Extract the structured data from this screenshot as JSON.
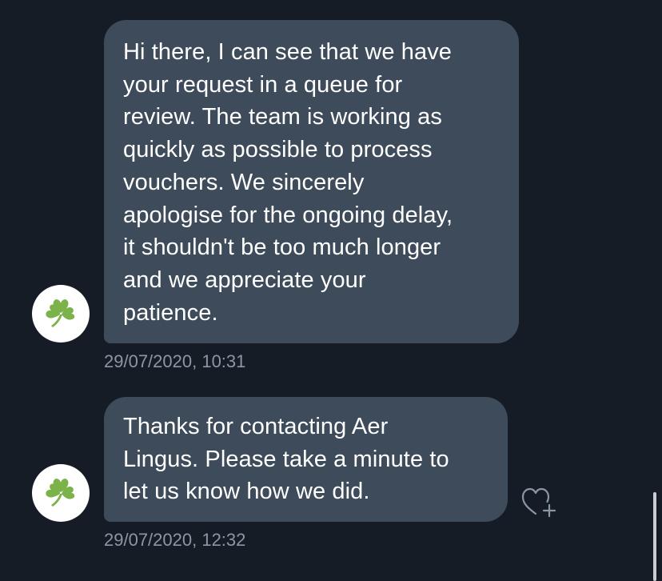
{
  "conversation": {
    "messages": [
      {
        "text": "Hi there, I can see that we have\nyour request in a queue for\nreview. The team is working as\nquickly as possible to process\nvouchers. We sincerely\napologise for the ongoing delay,\nit shouldn't be too much longer\nand we appreciate your\npatience.",
        "timestamp": "29/07/2020, 10:31",
        "avatar_icon": "shamrock-icon"
      },
      {
        "text": "Thanks for contacting Aer\nLingus. Please take a minute to\nlet us know how we did.",
        "timestamp": "29/07/2020, 12:32",
        "avatar_icon": "shamrock-icon",
        "reaction_icon": "heart-plus-icon"
      }
    ]
  },
  "colors": {
    "background": "#151c26",
    "bubble": "#3d4b5a",
    "timestamp": "#8b97a4",
    "shamrock": "#7bb24a"
  }
}
